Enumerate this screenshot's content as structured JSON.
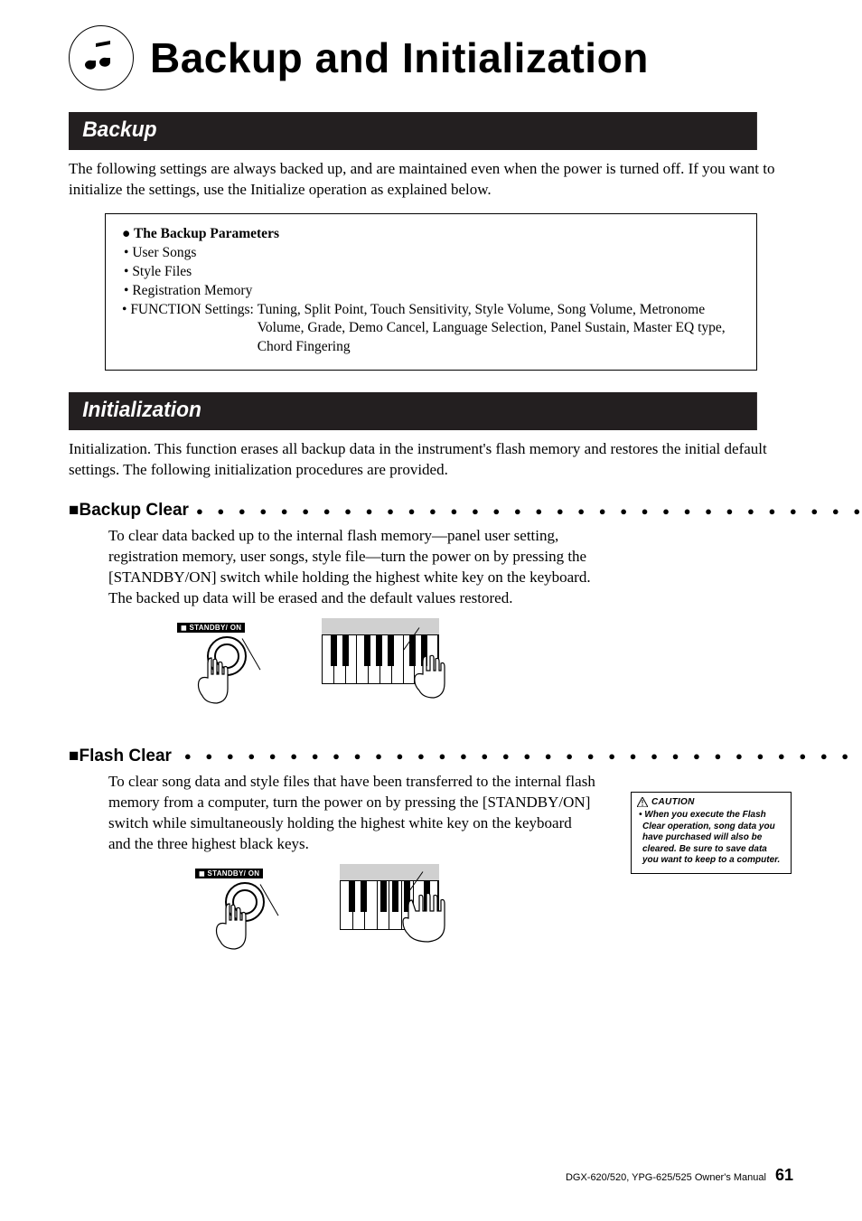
{
  "page_title": "Backup and Initialization",
  "sections": {
    "backup": {
      "heading": "Backup",
      "intro": "The following settings are always backked up, and are maintained even when the power is turned off. If you want to initialize the settings, use the Initialize operation as explained below.",
      "intro_actual": "The following settings are always backed up, and are maintained even when the power is turned off. If you want to initialize the settings, use the Initialize operation as explained below.",
      "param_box": {
        "header": "The Backup Parameters",
        "items": [
          "User Songs",
          "Style Files",
          "Registration Memory"
        ],
        "fn_label": "FUNCTION Settings: ",
        "fn_values": "Tuning, Split Point, Touch Sensitivity, Style Volume, Song Volume, Metronome Volume, Grade, Demo Cancel, Language Selection, Panel Sustain, Master EQ type, Chord Fingering"
      }
    },
    "init": {
      "heading": "Initialization",
      "intro": "Initialization. This function erases all backup data in the instrument's flash memory and restores the initial default settings. The following initialization procedures are provided.",
      "backup_clear": {
        "title": "Backup Clear",
        "body": "To clear data backed up to the internal flash memory—panel user setting, registration memory, user songs, style file—turn the power on by pressing the [STANDBY/ON] switch while holding the highest white key on the keyboard. The backed up data will be erased and the default values restored."
      },
      "flash_clear": {
        "title": "Flash Clear",
        "body": "To clear song data and style files that have been transferred to the internal flash memory from a computer, turn the power on by pressing the [STANDBY/ON] switch while simultaneously holding the highest white key on the keyboard and the three highest black keys."
      }
    }
  },
  "standby_label": "STANDBY/    ON",
  "caution": {
    "header": "CAUTION",
    "body": "• When you execute the Flash Clear operation, song data you have purchased will also be cleared. Be sure to save data you want to keep to a computer."
  },
  "footer": {
    "manual": "DGX-620/520, YPG-625/525  Owner's Manual",
    "page": "61"
  },
  "dots": "● ● ● ● ● ● ● ● ● ● ● ● ● ● ● ● ● ● ● ● ● ● ● ● ● ● ● ● ● ● ● ● ●"
}
